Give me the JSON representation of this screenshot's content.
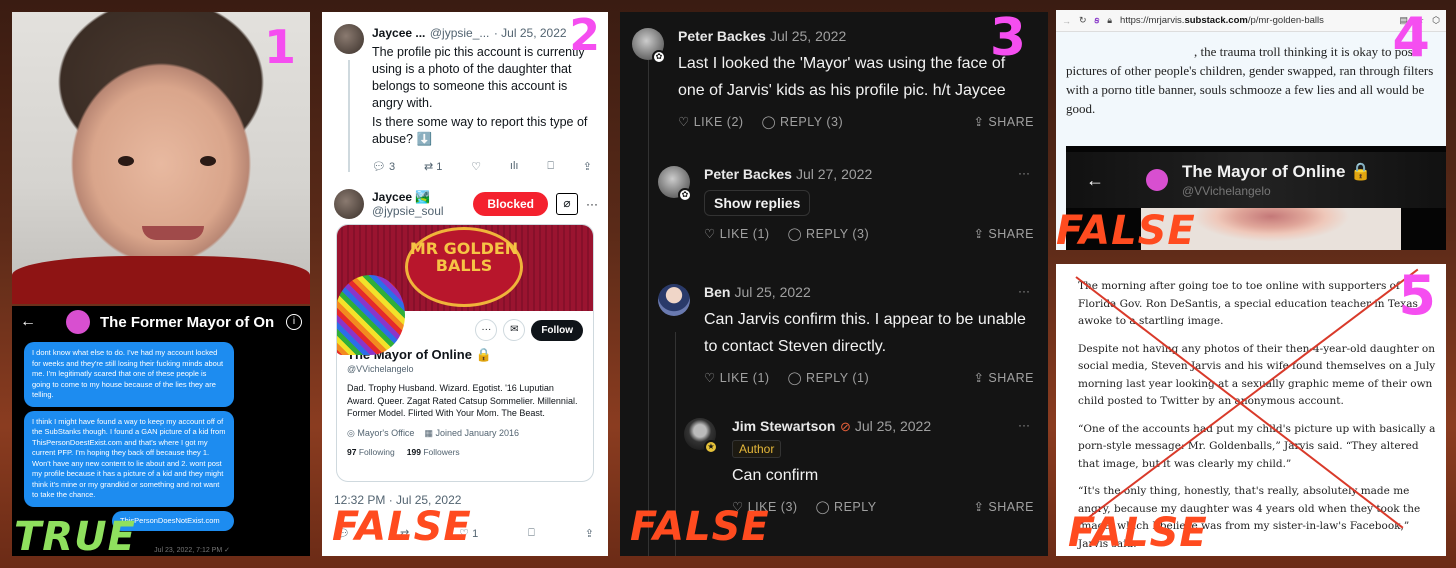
{
  "labels": {
    "panel_numbers": [
      "1",
      "2",
      "3",
      "4",
      "5"
    ],
    "verdicts": {
      "panel1": "TRUE",
      "panel2": "FALSE",
      "panel3": "FALSE",
      "panel4": "FALSE",
      "panel5": "FALSE"
    }
  },
  "colors": {
    "panel_number": "#f54ef0",
    "false_verdict": "#ff4b1f",
    "true_verdict": "#8fe05e",
    "twitter_blocked": "#f4212e",
    "dm_bubble": "#1d8cf0"
  },
  "panel1": {
    "photo_alt": "AI-generated photo of a smiling toddler in a red shirt",
    "dm": {
      "title": "The Former Mayor of On",
      "back_icon": "arrow-left-icon",
      "info_icon": "info-icon",
      "messages": [
        "I dont know what else to do. I've had my account locked for weeks and they're still losing their fucking minds about me. I'm legitimatly scared that one of these people is going to come to my house because of the lies they are telling.",
        "I think I might have found a way to keep my account off of the SubStanks though. I found a GAN picture of a kid from ThisPersonDoestExist.com and that's where I got my current PFP. I'm hoping they back off because they 1. Won't have any new content to lie about and 2. wont post my profile because it has a picture of a kid and they might think it's mine or my grandkid or something and not want to take the chance.",
        "ThisPersonDoesNotExist.com"
      ],
      "timestamp": "Jul 23, 2022, 7:12 PM ✓"
    }
  },
  "panel2": {
    "tweet": {
      "author_name": "Jaycee ...",
      "author_handle": "@jypsie_...",
      "date": "· Jul 25, 2022",
      "text_1": "The profile pic this account is currently using is a photo of the daughter that belongs to someone this account is angry with.",
      "text_2": "Is there some way to report this type of abuse? ⬇️",
      "replies": "3",
      "retweets": "1",
      "likes": "",
      "views": ""
    },
    "reply": {
      "author_name": "Jaycee 🏞️",
      "author_handle": "@jypsie_soul",
      "blocked_label": "Blocked",
      "more_label": "···"
    },
    "profile_card": {
      "banner_text": "MR GOLDEN BALLS",
      "name": "The Mayor of Online 🔒",
      "handle": "@VVichelangelo",
      "bio": "Dad. Trophy Husband. Wizard. Egotist. '16 Luputian Award. Queer. Zagat Rated Catsup Sommelier. Millennial. Former Model. Flirted With Your Mom. The Beast.",
      "location": "Mayor's Office",
      "joined": "Joined January 2016",
      "following_count": "97",
      "following_label": "Following",
      "followers_count": "199",
      "followers_label": "Followers",
      "follow_button": "Follow",
      "more_button": "···",
      "message_icon": "✉"
    },
    "timestamp": "12:32 PM · Jul 25, 2022",
    "bottom_like_count": "1"
  },
  "panel3": {
    "comments": [
      {
        "author": "Peter Backes",
        "date": "Jul 25, 2022",
        "text": "Last I looked the 'Mayor' was using the face of one of Jarvis' kids as his profile pic. h/t Jaycee",
        "like": "LIKE (2)",
        "reply": "REPLY (3)",
        "share": "SHARE"
      },
      {
        "author": "Peter Backes",
        "date": "Jul 27, 2022",
        "show_replies": "Show replies",
        "like": "LIKE (1)",
        "reply": "REPLY (3)",
        "share": "SHARE"
      },
      {
        "author": "Ben",
        "date": "Jul 25, 2022",
        "text": "Can Jarvis confirm this. I appear to be unable to contact Steven directly.",
        "like": "LIKE (1)",
        "reply": "REPLY (1)",
        "share": "SHARE"
      },
      {
        "author": "Jim Stewartson",
        "date": "Jul 25, 2022",
        "tag": "Author",
        "text": "Can confirm",
        "like": "LIKE (3)",
        "reply": "REPLY",
        "share": "SHARE"
      }
    ],
    "more_label": "···"
  },
  "panel4": {
    "url": "https://mrjarvis.substack.com/p/mr-golden-balls",
    "url_prefix": "https://mrjarvis.",
    "url_domain": "substack.com",
    "url_path": "/p/mr-golden-balls",
    "article_text": ", the trauma troll thinking it is okay to post pictures of other people's children, gender swapped, ran through filters with a porno title banner, souls schmooze a few lies and all would be good.",
    "profile_name": "The Mayor of Online 🔒",
    "profile_handle": "@VVichelangelo"
  },
  "panel5": {
    "paragraphs": [
      "The morning after going toe to toe online with supporters of Florida Gov. Ron DeSantis, a special education teacher in Texas awoke to a startling image.",
      "Despite not having any photos of their then-4-year-old daughter on social media, Steven Jarvis and his wife found themselves on a July morning last year looking at a sexually graphic meme of their own child posted to Twitter by an anonymous account.",
      "“One of the accounts had put my child's picture up with basically a porn-style message: Mr. Goldenballs,” Jarvis said. “They altered that image, but it was clearly my child.”",
      "“It's the only thing, honestly, that's really, absolutely made me angry, because my daughter was 4 years old when they took the image, which I believe was from my sister-in-law's Facebook,” Jarvis said."
    ]
  }
}
